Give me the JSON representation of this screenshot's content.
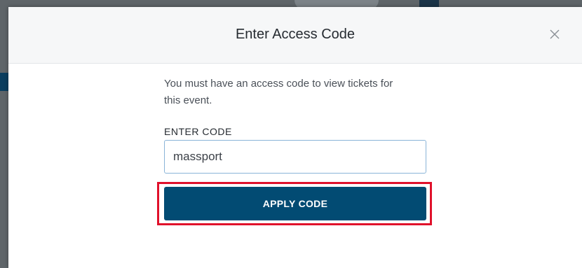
{
  "modal": {
    "title": "Enter Access Code",
    "description": "You must have an access code to view tickets for this event.",
    "field_label": "ENTER CODE",
    "code_value": "massport",
    "apply_label": "APPLY CODE",
    "close_icon": "close-icon"
  },
  "colors": {
    "button": "#024b73",
    "highlight": "#e0112b",
    "input_border": "#8ab4d8",
    "header_bg": "#f6f7f8"
  }
}
